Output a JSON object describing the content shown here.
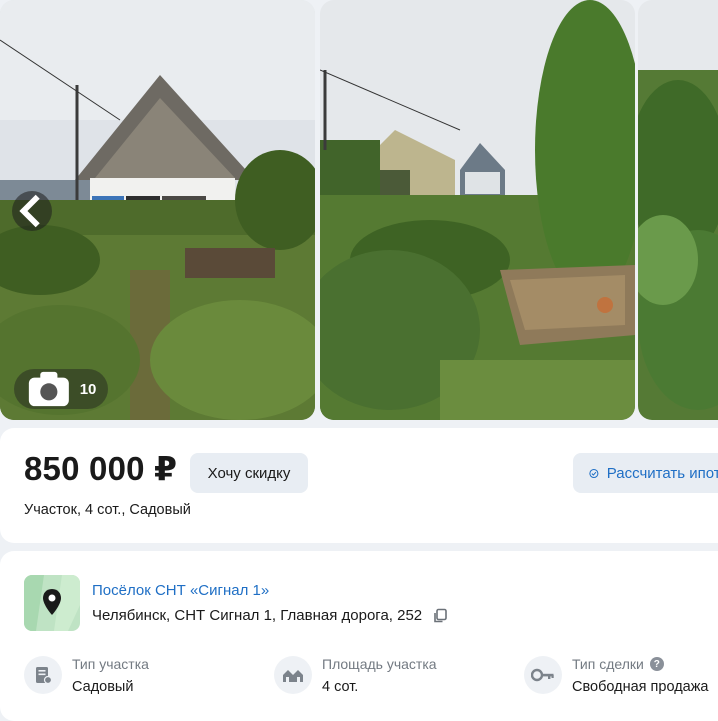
{
  "gallery": {
    "photo_count": "10",
    "photos": [
      {
        "description_icon": "garden-house-photo"
      },
      {
        "description_icon": "greenhouse-garden-photo"
      },
      {
        "description_icon": "apple-tree-photo"
      }
    ]
  },
  "listing": {
    "price": "850 000 ₽",
    "discount_button": "Хочу скидку",
    "mortgage_button": "Рассчитать ипотеку",
    "subtitle": "Участок, 4 сот., Садовый"
  },
  "location": {
    "village": "Посёлок СНТ «Сигнал 1»",
    "address": "Челябинск, СНТ Сигнал 1, Главная дорога, 252"
  },
  "params": [
    {
      "label": "Тип участка",
      "value": "Садовый",
      "icon": "plot-type-icon"
    },
    {
      "label": "Площадь участка",
      "value": "4 сот.",
      "icon": "area-icon"
    },
    {
      "label": "Тип сделки",
      "value": "Свободная продажа",
      "icon": "key-icon"
    }
  ],
  "colors": {
    "accent": "#1f6fc5",
    "background": "#eef1f5",
    "button_bg": "#e8edf3"
  }
}
